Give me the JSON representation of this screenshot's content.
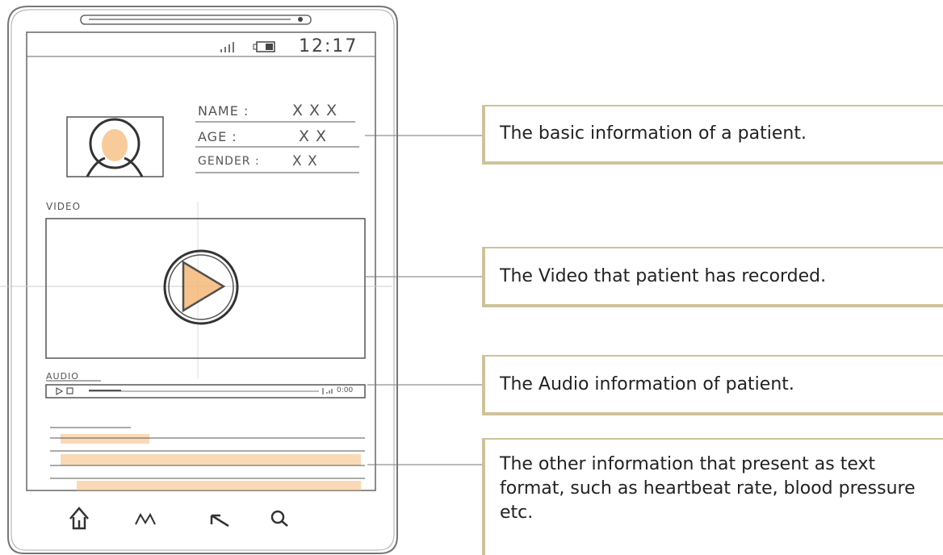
{
  "status_bar": {
    "time": "12:17"
  },
  "profile": {
    "name_label": "NAME :",
    "name_value": "X X X",
    "age_label": "AGE   :",
    "age_value": "X X",
    "gender_label": "GENDER :",
    "gender_value": "X X"
  },
  "video_section": {
    "label": "VIDEO"
  },
  "audio_section": {
    "label": "AUDIO",
    "time": "0:00"
  },
  "nav_icons": [
    "home-icon",
    "chart-icon",
    "back-icon",
    "search-icon"
  ],
  "callouts": [
    {
      "text": "The basic information of a patient."
    },
    {
      "text": "The Video that patient has recorded."
    },
    {
      "text": "The Audio information of patient."
    },
    {
      "text": "The other information that present as text format, such as heartbeat rate, blood pressure etc."
    }
  ],
  "colors": {
    "accent": "#cfc29a",
    "highlight": "#f5b97a",
    "sketch": "#555555"
  }
}
